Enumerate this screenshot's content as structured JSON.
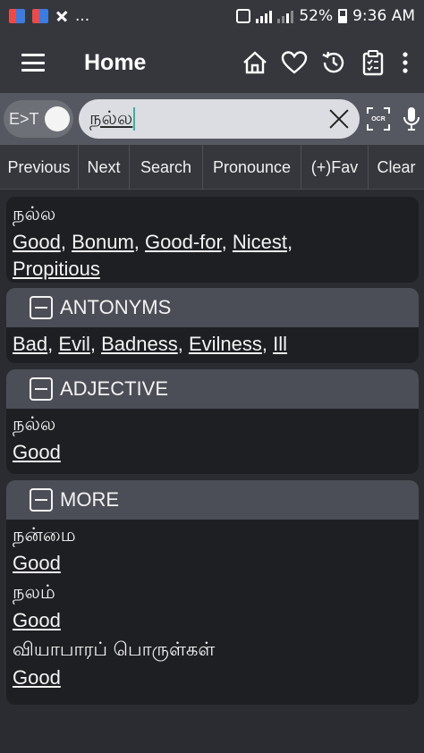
{
  "status_bar": {
    "left_extra": "...",
    "battery": "52%",
    "time": "9:36 AM"
  },
  "app_bar": {
    "title": "Home",
    "icons": [
      "home-icon",
      "heart-icon",
      "history-icon",
      "clipboard-icon",
      "more-icon"
    ]
  },
  "search": {
    "mode_toggle": "E>T",
    "query": "நல்ல",
    "ocr_label": "OCR"
  },
  "buttons": [
    "Previous",
    "Next",
    "Search",
    "Pronounce",
    "(+)Fav",
    "Clear"
  ],
  "main_result": {
    "word": "நல்ல",
    "translations": [
      "Good",
      "Bonum",
      "Good-for",
      "Nicest",
      "Propitious"
    ]
  },
  "antonyms": {
    "header": "ANTONYMS",
    "items": [
      "Bad",
      "Evil",
      "Badness",
      "Evilness",
      "Ill"
    ]
  },
  "adjective": {
    "header": "ADJECTIVE",
    "word": "நல்ல",
    "translation": "Good"
  },
  "more": {
    "header": "MORE",
    "entries": [
      {
        "word": "நன்மை",
        "translation": "Good"
      },
      {
        "word": "நலம்",
        "translation": "Good"
      },
      {
        "word": "வியாபாரப் பொருள்கள்",
        "translation": "Good"
      }
    ]
  }
}
